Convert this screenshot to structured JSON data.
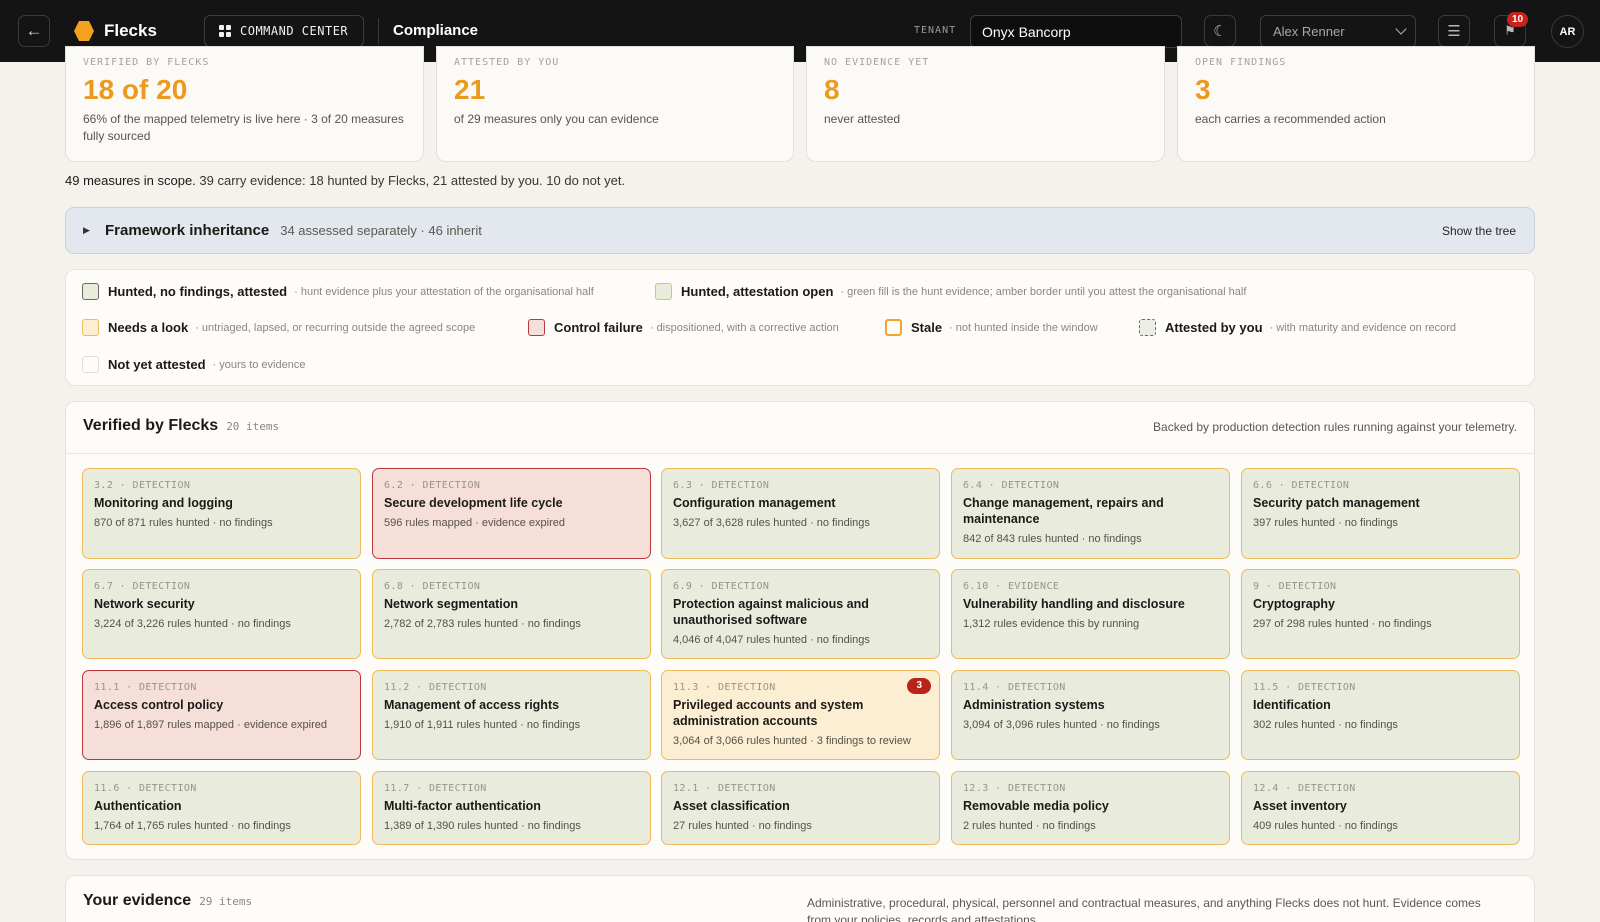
{
  "topbar": {
    "back_icon": "arrow-left-icon",
    "brand": "Flecks",
    "brand_color": "#f3a11e",
    "command_center_label": "COMMAND CENTER",
    "title": "Compliance",
    "tenant_label": "TENANT",
    "tenant_value": "Onyx Bancorp",
    "theme_icon": "moon-icon",
    "user_selected": "Alex Renner",
    "menu_icon": "hamburger-icon",
    "notifications_icon": "flag-icon",
    "notifications_count": "10",
    "avatar_initials": "AR"
  },
  "stats": [
    {
      "label": "VERIFIED BY FLECKS",
      "value": "18 of 20",
      "sub": "66% of the mapped telemetry is live here · 3 of 20 measures fully sourced"
    },
    {
      "label": "ATTESTED BY YOU",
      "value": "21",
      "sub": "of 29 measures only you can evidence"
    },
    {
      "label": "NO EVIDENCE YET",
      "value": "8",
      "sub": "never attested"
    },
    {
      "label": "OPEN FINDINGS",
      "value": "3",
      "sub": "each carries a recommended action"
    }
  ],
  "scope": {
    "lead": "49 measures in scope.",
    "rest": " 39 carry evidence: 18 hunted by Flecks, 21 attested by you. 10 do not yet."
  },
  "inheritance": {
    "title": "Framework inheritance",
    "sub": "34 assessed separately · 46 inherit",
    "action": "Show the tree"
  },
  "legend": [
    {
      "name": "Hunted, no findings, attested",
      "desc": "· hunt evidence plus your attestation of the organisational half"
    },
    {
      "name": "Hunted, attestation open",
      "desc": "· green fill is the hunt evidence; amber border until you attest the organisational half"
    },
    {
      "name": "Needs a look",
      "desc": "· untriaged, lapsed, or recurring outside the agreed scope"
    },
    {
      "name": "Control failure",
      "desc": "· dispositioned, with a corrective action"
    },
    {
      "name": "Stale",
      "desc": "· not hunted inside the window"
    },
    {
      "name": "Attested by you",
      "desc": "· with maturity and evidence on record"
    },
    {
      "name": "Not yet attested",
      "desc": "· yours to evidence"
    }
  ],
  "verified": {
    "title": "Verified by Flecks",
    "count": "20 items",
    "note": "Backed by production detection rules running against your telemetry.",
    "cards": [
      {
        "id": "3.2 · DETECTION",
        "title": "Monitoring and logging",
        "detail": "870 of 871 rules hunted · no findings",
        "status": "attest-open"
      },
      {
        "id": "6.2 · DETECTION",
        "title": "Secure development life cycle",
        "detail": "596 rules mapped · evidence expired",
        "status": "control-failure"
      },
      {
        "id": "6.3 · DETECTION",
        "title": "Configuration management",
        "detail": "3,627 of 3,628 rules hunted · no findings",
        "status": "attest-open"
      },
      {
        "id": "6.4 · DETECTION",
        "title": "Change management, repairs and maintenance",
        "detail": "842 of 843 rules hunted · no findings",
        "status": "attest-open"
      },
      {
        "id": "6.6 · DETECTION",
        "title": "Security patch management",
        "detail": "397 rules hunted · no findings",
        "status": "attest-open"
      },
      {
        "id": "6.7 · DETECTION",
        "title": "Network security",
        "detail": "3,224 of 3,226 rules hunted · no findings",
        "status": "attest-open"
      },
      {
        "id": "6.8 · DETECTION",
        "title": "Network segmentation",
        "detail": "2,782 of 2,783 rules hunted · no findings",
        "status": "attest-open"
      },
      {
        "id": "6.9 · DETECTION",
        "title": "Protection against malicious and unauthorised software",
        "detail": "4,046 of 4,047 rules hunted · no findings",
        "status": "attest-open"
      },
      {
        "id": "6.10 · EVIDENCE",
        "title": "Vulnerability handling and disclosure",
        "detail": "1,312 rules evidence this by running",
        "status": "attest-open"
      },
      {
        "id": "9 · DETECTION",
        "title": "Cryptography",
        "detail": "297 of 298 rules hunted · no findings",
        "status": "attest-open"
      },
      {
        "id": "11.1 · DETECTION",
        "title": "Access control policy",
        "detail": "1,896 of 1,897 rules mapped · evidence expired",
        "status": "control-failure"
      },
      {
        "id": "11.2 · DETECTION",
        "title": "Management of access rights",
        "detail": "1,910 of 1,911 rules hunted · no findings",
        "status": "attest-open"
      },
      {
        "id": "11.3 · DETECTION",
        "title": "Privileged accounts and system administration accounts",
        "detail": "3,064 of 3,066 rules hunted · 3 findings to review",
        "status": "needs-look",
        "badge": "3"
      },
      {
        "id": "11.4 · DETECTION",
        "title": "Administration systems",
        "detail": "3,094 of 3,096 rules hunted · no findings",
        "status": "attest-open"
      },
      {
        "id": "11.5 · DETECTION",
        "title": "Identification",
        "detail": "302 rules hunted · no findings",
        "status": "attest-open"
      },
      {
        "id": "11.6 · DETECTION",
        "title": "Authentication",
        "detail": "1,764 of 1,765 rules hunted · no findings",
        "status": "attest-open"
      },
      {
        "id": "11.7 · DETECTION",
        "title": "Multi-factor authentication",
        "detail": "1,389 of 1,390 rules hunted · no findings",
        "status": "attest-open"
      },
      {
        "id": "12.1 · DETECTION",
        "title": "Asset classification",
        "detail": "27 rules hunted · no findings",
        "status": "attest-open"
      },
      {
        "id": "12.3 · DETECTION",
        "title": "Removable media policy",
        "detail": "2 rules hunted · no findings",
        "status": "attest-open"
      },
      {
        "id": "12.4 · DETECTION",
        "title": "Asset inventory",
        "detail": "409 rules hunted · no findings",
        "status": "attest-open"
      }
    ]
  },
  "evidence": {
    "title": "Your evidence",
    "count": "29 items",
    "note": "Administrative, procedural, physical, personnel and contractual measures, and anything Flecks does not hunt. Evidence comes from your policies, records and attestations."
  },
  "colors": {
    "accent": "#ec9a1e",
    "hunt_fill": "#e9ecdc",
    "amber_border": "#efba59",
    "failure_fill": "#f5dfd8",
    "failure_border": "#b9383c",
    "needs_look_fill": "#fbeed2",
    "badge_red": "#c8231b"
  }
}
